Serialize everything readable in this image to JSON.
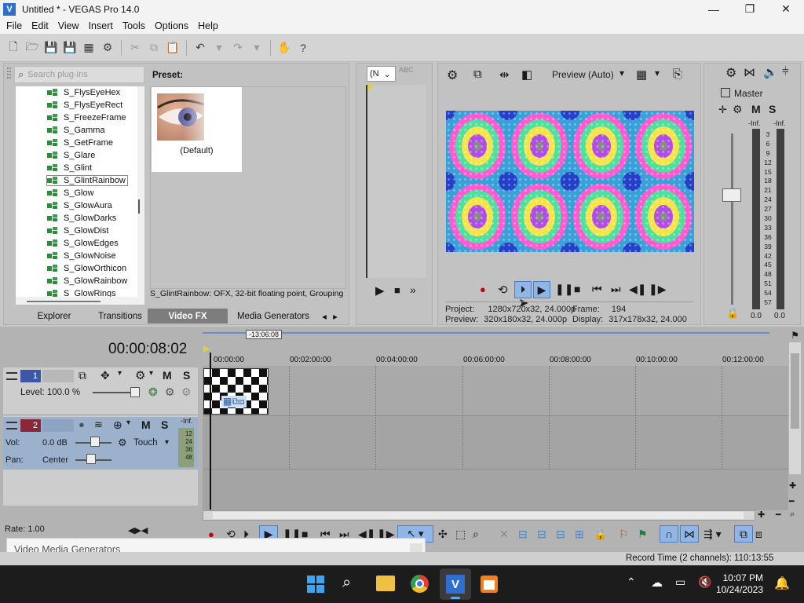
{
  "window": {
    "title": "Untitled * - VEGAS Pro 14.0",
    "logo_icon": "vegas-logo-icon",
    "minimize_glyph": "—",
    "maximize_glyph": "❐",
    "close_glyph": "✕"
  },
  "menu": [
    "File",
    "Edit",
    "View",
    "Insert",
    "Tools",
    "Options",
    "Help"
  ],
  "plugin_browser": {
    "search_placeholder": "Search plug-ins",
    "items": [
      "S_FlysEyeHex",
      "S_FlysEyeRect",
      "S_FreezeFrame",
      "S_Gamma",
      "S_GetFrame",
      "S_Glare",
      "S_Glint",
      "S_GlintRainbow",
      "S_Glow",
      "S_GlowAura",
      "S_GlowDarks",
      "S_GlowDist",
      "S_GlowEdges",
      "S_GlowNoise",
      "S_GlowOrthicon",
      "S_GlowRainbow",
      "S_GlowRings"
    ],
    "selected": "S_GlintRainbow",
    "preset_label": "Preset:",
    "preset_name": "(Default)",
    "status": "S_GlintRainbow: OFX, 32-bit floating point, Grouping",
    "tabs": [
      "Explorer",
      "Transitions",
      "Video FX",
      "Media Generators"
    ],
    "active_tab": "Video FX"
  },
  "trimmer": {
    "dropdown_value": "(N"
  },
  "preview": {
    "quality": "Preview (Auto)",
    "project_label": "Project:",
    "project_value": "1280x720x32, 24.000p",
    "preview_label": "Preview:",
    "preview_value": "320x180x32, 24.000p",
    "frame_label": "Frame:",
    "frame_value": "194",
    "display_label": "Display:",
    "display_value": "317x178x32, 24.000"
  },
  "master": {
    "label": "Master",
    "m_label": "M",
    "s_label": "S",
    "left_peak": "-Inf.",
    "right_peak": "-Inf.",
    "scale": [
      "3",
      "6",
      "9",
      "12",
      "15",
      "18",
      "21",
      "24",
      "27",
      "30",
      "33",
      "36",
      "39",
      "42",
      "45",
      "48",
      "51",
      "54",
      "57"
    ],
    "left_value": "0.0",
    "right_value": "0.0"
  },
  "timeline": {
    "timecode": "00:00:08:02",
    "cursor_marker": "-13:06:08",
    "ruler": [
      "00:00:00",
      "00:02:00:00",
      "00:04:00:00",
      "00:06:00:00",
      "00:08:00:00",
      "00:10:00:00",
      "00:12:00:00"
    ],
    "rate": "Rate: 1.00",
    "track1": {
      "number": "1",
      "level": "Level: 100.0 %",
      "m": "M",
      "s": "S"
    },
    "track2": {
      "number": "2",
      "vol_label": "Vol:",
      "vol_value": "0.0 dB",
      "pan_label": "Pan:",
      "pan_value": "Center",
      "touch": "Touch",
      "peak": "-Inf.",
      "meter": [
        "12",
        "24",
        "36",
        "48"
      ],
      "m": "M",
      "s": "S"
    }
  },
  "hint": "Video Media Generators",
  "record_time": "Record Time (2 channels): 110:13:55",
  "clock": {
    "time": "10:07 PM",
    "date": "10/24/2023"
  },
  "colors": {
    "accent": "#2f6fd0",
    "track2": "#9cb1cc",
    "taskbar": "#1c1c1c"
  }
}
